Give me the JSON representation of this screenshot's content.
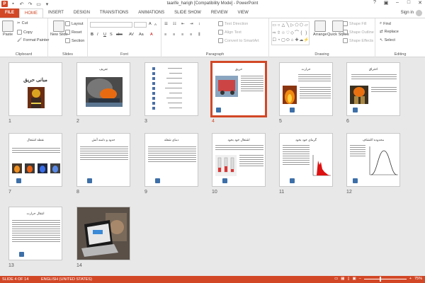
{
  "window": {
    "title": "taarife_harigh [Compatibility Mode] - PowerPoint"
  },
  "tabs": [
    "FILE",
    "HOME",
    "INSERT",
    "DESIGN",
    "TRANSITIONS",
    "ANIMATIONS",
    "SLIDE SHOW",
    "REVIEW",
    "VIEW"
  ],
  "signin": "Sign in",
  "ribbon": {
    "clipboard": {
      "paste": "Paste",
      "cut": "Cut",
      "copy": "Copy",
      "format_painter": "Format Painter",
      "label": "Clipboard"
    },
    "slides": {
      "new_slide": "New Slide",
      "layout": "Layout",
      "reset": "Reset",
      "section": "Section",
      "label": "Slides"
    },
    "font": {
      "label": "Font"
    },
    "paragraph": {
      "text_direction": "Text Direction",
      "align_text": "Align Text",
      "smartart": "Convert to SmartArt",
      "label": "Paragraph"
    },
    "drawing": {
      "arrange": "Arrange",
      "quick_styles": "Quick Styles",
      "shape_fill": "Shape Fill",
      "shape_outline": "Shape Outline",
      "shape_effects": "Shape Effects",
      "label": "Drawing"
    },
    "editing": {
      "find": "Find",
      "replace": "Replace",
      "select": "Select",
      "label": "Editing"
    }
  },
  "slides": [
    {
      "number": "1",
      "title": "مبانی حریق"
    },
    {
      "number": "2",
      "title": "تعریف"
    },
    {
      "number": "3",
      "title": ""
    },
    {
      "number": "4",
      "title": "حریق"
    },
    {
      "number": "5",
      "title": "حرارت"
    },
    {
      "number": "6",
      "title": "احتراق"
    },
    {
      "number": "7",
      "title": "نقطه اشتعال"
    },
    {
      "number": "8",
      "title": "حدود و دامنه آتش"
    },
    {
      "number": "9",
      "title": "دمای شعله"
    },
    {
      "number": "10",
      "title": "اشتعال خود بخود"
    },
    {
      "number": "11",
      "title": "گرمای خود بخود"
    },
    {
      "number": "12",
      "title": "محدوده اکتشاف"
    },
    {
      "number": "13",
      "title": "انتقال حرارت"
    },
    {
      "number": "14",
      "title": ""
    }
  ],
  "selected_slide": "4",
  "status": {
    "slide": "SLIDE 4 OF 14",
    "language": "ENGLISH (UNITED STATES)",
    "zoom": "75%"
  },
  "colors": {
    "accent": "#d24726",
    "icon_blue": "#3d6fa8"
  }
}
